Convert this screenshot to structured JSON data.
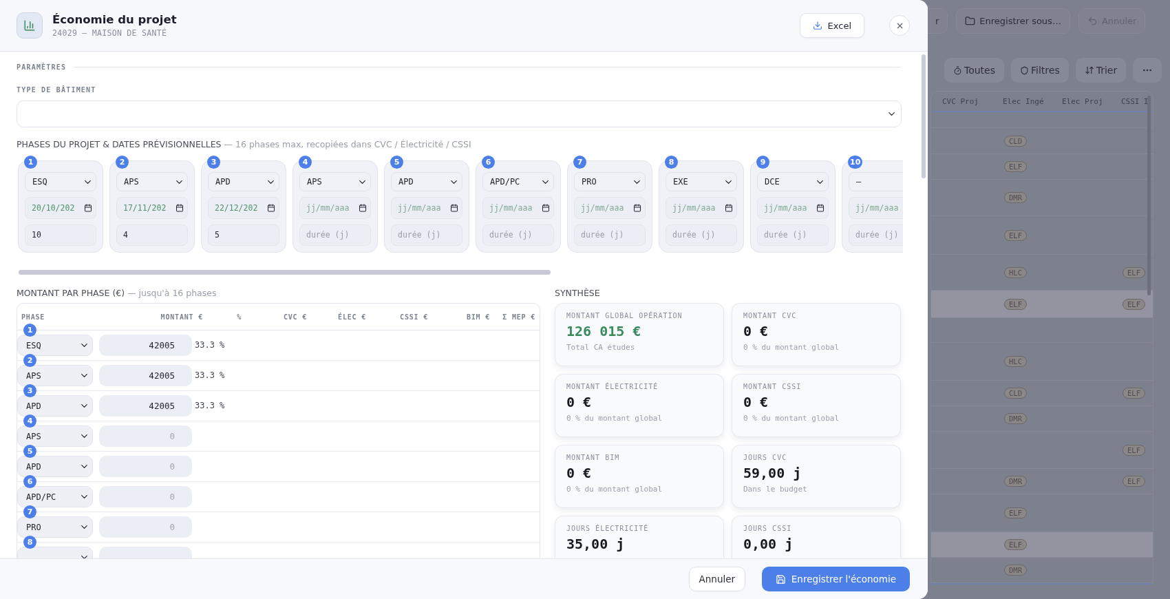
{
  "modal": {
    "title": "Économie du projet",
    "subtitle": "24029 — MAISON DE SANTÉ",
    "export_button": "Excel"
  },
  "parameters": {
    "heading": "PARAMÈTRES",
    "building_type_label": "TYPE DE BÂTIMENT"
  },
  "phases": {
    "title": "PHASES DU PROJET & DATES PRÉVISIONNELLES",
    "note": "— 16 phases max, recopiées dans CVC / Électricité / CSSI",
    "items": [
      {
        "number": "1",
        "phase": "ESQ",
        "date": "20/10/202",
        "duration": "10"
      },
      {
        "number": "2",
        "phase": "APS",
        "date": "17/11/202",
        "duration": "4"
      },
      {
        "number": "3",
        "phase": "APD",
        "date": "22/12/202",
        "duration": "5"
      },
      {
        "number": "4",
        "phase": "APS",
        "date_placeholder": "jj/mm/aaa",
        "duration_placeholder": "durée (j)"
      },
      {
        "number": "5",
        "phase": "APD",
        "date_placeholder": "jj/mm/aaa",
        "duration_placeholder": "durée (j)"
      },
      {
        "number": "6",
        "phase": "APD/PC",
        "date_placeholder": "jj/mm/aaa",
        "duration_placeholder": "durée (j)"
      },
      {
        "number": "7",
        "phase": "PRO",
        "date_placeholder": "jj/mm/aaa",
        "duration_placeholder": "durée (j)"
      },
      {
        "number": "8",
        "phase": "EXE",
        "date_placeholder": "jj/mm/aaa",
        "duration_placeholder": "durée (j)"
      },
      {
        "number": "9",
        "phase": "DCE",
        "date_placeholder": "jj/mm/aaa",
        "duration_placeholder": "durée (j)"
      },
      {
        "number": "10",
        "phase": "—",
        "date_placeholder": "jj/mm/aaa",
        "duration_placeholder": "durée (j)"
      }
    ]
  },
  "amounts": {
    "title": "MONTANT PAR PHASE (€)",
    "note": "— jusqu'à 16 phases",
    "columns": [
      "PHASE",
      "MONTANT €",
      "%",
      "CVC €",
      "ÉLEC €",
      "CSSI €",
      "BIM €",
      "Σ MEP €"
    ],
    "rows": [
      {
        "number": "1",
        "phase": "ESQ",
        "amount": "42005",
        "percent": "33.3 %"
      },
      {
        "number": "2",
        "phase": "APS",
        "amount": "42005",
        "percent": "33.3 %"
      },
      {
        "number": "3",
        "phase": "APD",
        "amount": "42005",
        "percent": "33.3 %"
      },
      {
        "number": "4",
        "phase": "APS",
        "amount_placeholder": "0"
      },
      {
        "number": "5",
        "phase": "APD",
        "amount_placeholder": "0"
      },
      {
        "number": "6",
        "phase": "APD/PC",
        "amount_placeholder": "0"
      },
      {
        "number": "7",
        "phase": "PRO",
        "amount_placeholder": "0"
      },
      {
        "number": "8"
      }
    ]
  },
  "synthesis": {
    "title": "SYNTHÈSE",
    "cards": [
      {
        "label": "MONTANT GLOBAL OPÉRATION",
        "value": "126 015 €",
        "note": "Total CA études",
        "highlight": true
      },
      {
        "label": "MONTANT CVC",
        "value": "0 €",
        "note": "0 % du montant global",
        "highlight": false
      },
      {
        "label": "MONTANT ÉLECTRICITÉ",
        "value": "0 €",
        "note": "0 % du montant global",
        "highlight": false
      },
      {
        "label": "MONTANT CSSI",
        "value": "0 €",
        "note": "0 % du montant global",
        "highlight": false
      },
      {
        "label": "MONTANT BIM",
        "value": "0 €",
        "note": "0 % du montant global",
        "highlight": false
      },
      {
        "label": "JOURS CVC",
        "value": "59,00 j",
        "note": "Dans le budget",
        "highlight": false
      },
      {
        "label": "JOURS ÉLECTRICITÉ",
        "value": "35,00 j",
        "highlight": false
      },
      {
        "label": "JOURS CSSI",
        "value": "0,00 j",
        "highlight": false
      }
    ]
  },
  "footer": {
    "cancel": "Annuler",
    "save": "Enregistrer l'économie"
  },
  "background": {
    "toolbar": [
      {
        "label": "r",
        "disabled": false
      },
      {
        "label": "Enregistrer sous…",
        "disabled": false
      },
      {
        "label": "Annuler",
        "disabled": true
      }
    ],
    "filters": [
      "Toutes",
      "Filtres",
      "Trier"
    ],
    "columns": [
      "CVC Proj",
      "Elec Ingé",
      "Elec Proj",
      "CSSI I"
    ],
    "rows": [
      {
        "highlighted": false
      },
      {
        "elec_inge": "CLD",
        "highlighted": false
      },
      {
        "elec_inge": "ELF",
        "highlighted": false
      },
      {
        "elec_inge": "DMR",
        "highlighted": false
      },
      {
        "elec_inge": "ELF",
        "highlighted": false
      },
      {
        "elec_inge": "HLC",
        "cssi": "ELF",
        "highlighted": false
      },
      {
        "elec_inge": "ELF",
        "cssi": "ELF",
        "highlighted": true
      },
      {
        "highlighted": false
      },
      {
        "elec_inge": "HLC",
        "highlighted": false
      },
      {
        "elec_inge": "CLD",
        "cssi": "ELF",
        "highlighted": false
      },
      {
        "elec_inge": "DMR",
        "highlighted": false
      },
      {
        "cssi": "ELF",
        "highlighted": false
      },
      {
        "elec_inge": "DMR",
        "cssi": "ELF",
        "highlighted": false
      },
      {
        "elec_inge": "ELF",
        "highlighted": false
      },
      {
        "elec_inge": "ELF",
        "highlighted": true
      },
      {
        "elec_inge": "DMR",
        "highlighted": false
      }
    ]
  }
}
